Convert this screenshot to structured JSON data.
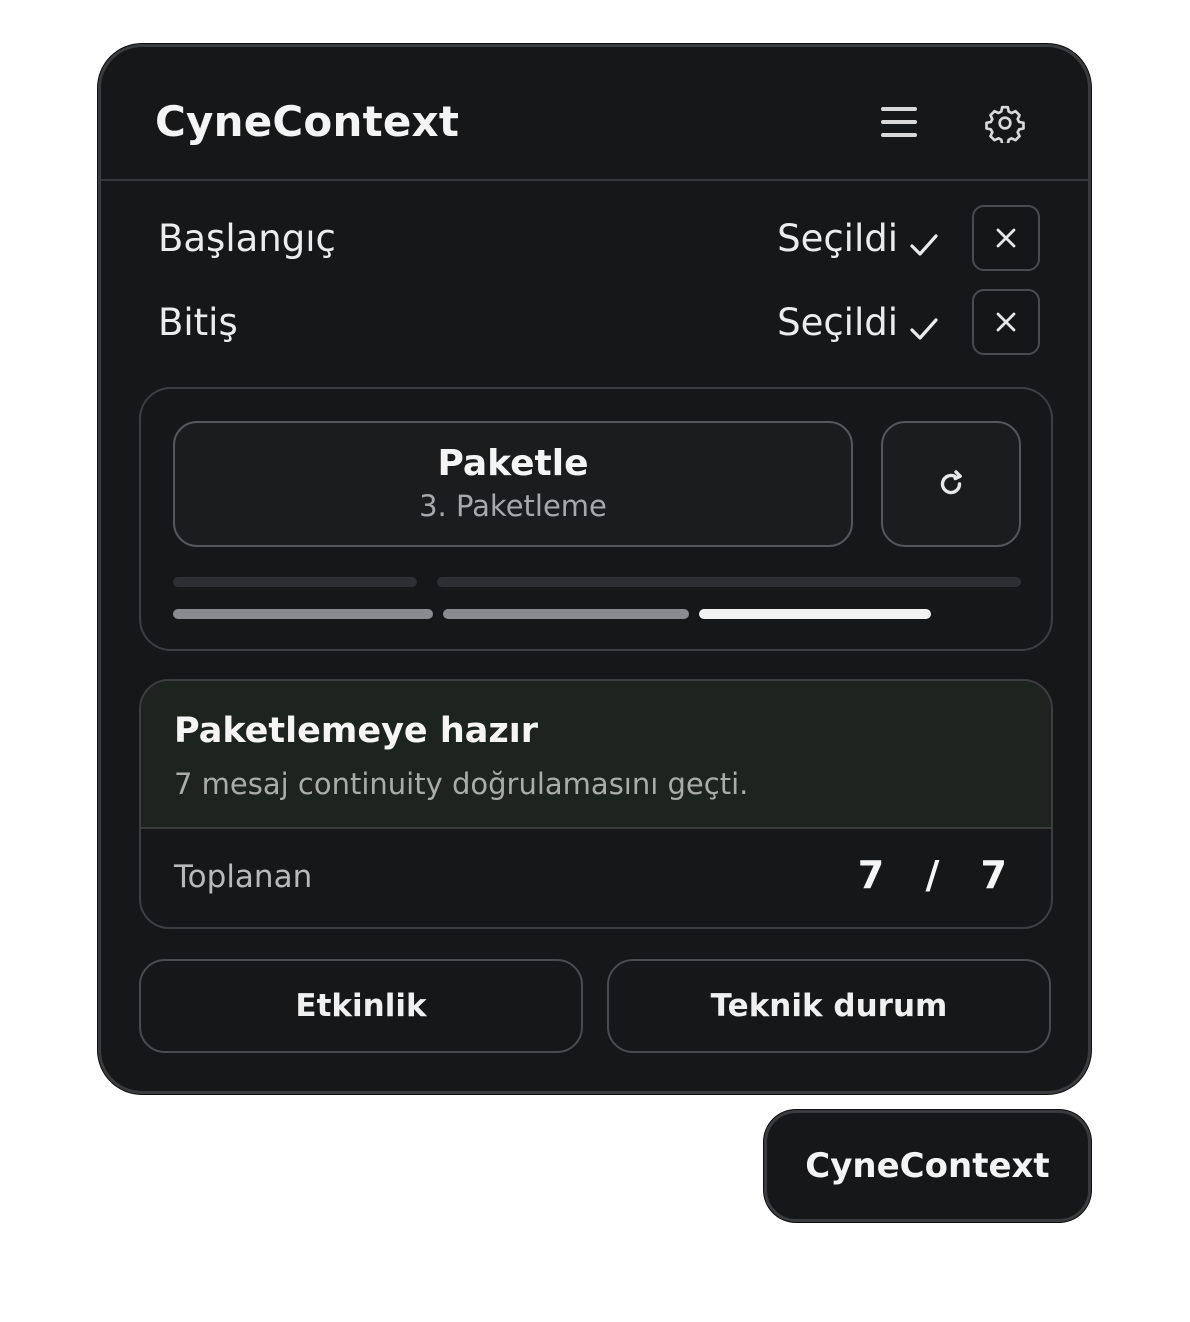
{
  "header": {
    "title": "CyneContext",
    "menu_icon": "hamburger-menu-icon",
    "settings_icon": "gear-icon"
  },
  "range": {
    "start": {
      "label": "Başlangıç",
      "status": "Seçildi",
      "clear_icon": "close-icon"
    },
    "end": {
      "label": "Bitiş",
      "status": "Seçildi",
      "clear_icon": "close-icon"
    }
  },
  "pack": {
    "button_title": "Paketle",
    "button_subtitle": "3. Paketleme",
    "refresh_icon": "refresh-icon",
    "progress_steps_total": 3,
    "progress_step_current": 3
  },
  "status": {
    "title": "Paketlemeye hazır",
    "description": "7 mesaj continuity doğrulamasını geçti.",
    "collected_label": "Toplanan",
    "collected_value": "7 / 7"
  },
  "footer": {
    "activity_label": "Etkinlik",
    "technical_label": "Teknik durum"
  },
  "launcher": {
    "label": "CyneContext"
  },
  "colors": {
    "panel_bg": "#161719",
    "ready_bg": "#1d231f",
    "progress_active": "#f2f2f2",
    "progress_done": "#8a8b8e",
    "progress_track": "#2e2f32"
  }
}
